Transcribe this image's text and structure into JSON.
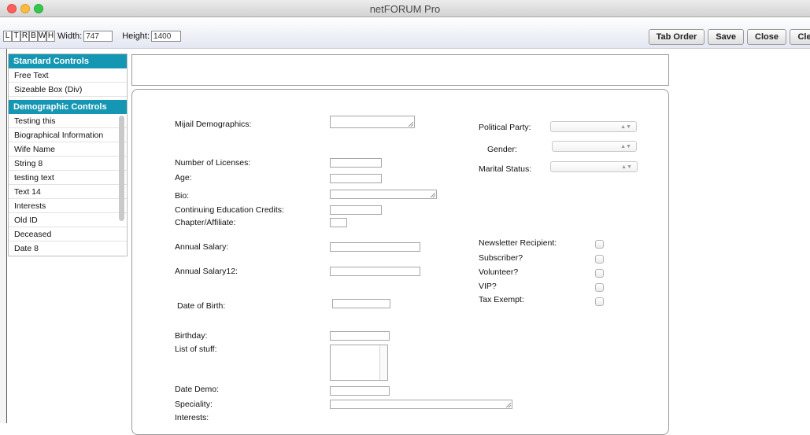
{
  "window": {
    "title": "netFORUM Pro"
  },
  "toolbar": {
    "letters": [
      "L",
      "T",
      "R",
      "B",
      "W",
      "H"
    ],
    "width_label": "Width:",
    "width_value": "747",
    "height_label": "Height:",
    "height_value": "1400",
    "buttons": {
      "tab_order": "Tab Order",
      "save": "Save",
      "close": "Close",
      "clear": "Cle"
    }
  },
  "sidebar": {
    "standard_header": "Standard Controls",
    "standard_items": [
      "Free Text",
      "Sizeable Box (Div)"
    ],
    "demographic_header": "Demographic Controls",
    "demographic_items": [
      "Testing this",
      "Biographical Information",
      "Wife Name",
      "String 8",
      "testing text",
      "Text 14",
      "Interests",
      "Old ID",
      "Deceased",
      "Date 8"
    ]
  },
  "form": {
    "mijail_demographics": "Mijail Demographics:",
    "number_of_licenses": "Number of Licenses:",
    "age": "Age:",
    "bio": "Bio:",
    "continuing_education_credits": "Continuing Education Credits:",
    "chapter_affiliate": "Chapter/Affiliate:",
    "annual_salary": "Annual Salary:",
    "annual_salary12": "Annual Salary12:",
    "date_of_birth": "Date of Birth:",
    "birthday": "Birthday:",
    "list_of_stuff": "List of stuff:",
    "date_demo": "Date Demo:",
    "speciality": "Speciality:",
    "interests": "Interests:",
    "political_party": "Political Party:",
    "gender": "Gender:",
    "marital_status": "Marital Status:",
    "newsletter_recipient": "Newsletter Recipient:",
    "subscriber": "Subscriber?",
    "volunteer": "Volunteer?",
    "vip": "VIP?",
    "tax_exempt": "Tax Exempt:"
  }
}
